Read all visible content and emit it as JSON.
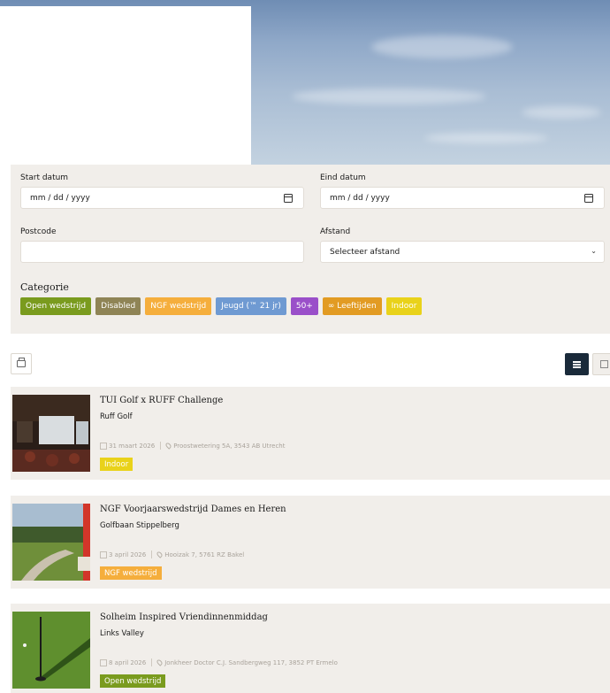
{
  "colors": {
    "panel_bg": "#f1eeea",
    "open": "#7a9b1e",
    "disabled": "#8f8456",
    "ngf": "#f5ae3c",
    "jeugd": "#6f9ad2",
    "plus50": "#9a4fc9",
    "leeftijden": "#e29b23",
    "indoor": "#e9d21a",
    "view_active": "#1a2a3a"
  },
  "filters": {
    "start_label": "Start datum",
    "start_placeholder": "mm / dd / yyyy",
    "end_label": "Eind datum",
    "end_placeholder": "mm / dd / yyyy",
    "postcode_label": "Postcode",
    "postcode_value": "",
    "distance_label": "Afstand",
    "distance_selected": "Selecteer afstand",
    "category_title": "Categorie",
    "categories": [
      {
        "label": "Open wedstrijd",
        "color": "#7a9b1e"
      },
      {
        "label": "Disabled",
        "color": "#8f8456"
      },
      {
        "label": "NGF wedstrijd",
        "color": "#f5ae3c"
      },
      {
        "label": "Jeugd (™ 21 jr)",
        "color": "#6f9ad2"
      },
      {
        "label": "50+",
        "color": "#9a4fc9"
      },
      {
        "label": "∞ Leeftijden",
        "color": "#e29b23"
      },
      {
        "label": "Indoor",
        "color": "#e9d21a"
      }
    ]
  },
  "toolbar": {
    "print_icon": "print-icon",
    "list_view_icon": "list-view-icon",
    "calendar_view_icon": "calendar-view-icon"
  },
  "events": [
    {
      "title": "TUI Golf x RUFF Challenge",
      "venue": "Ruff Golf",
      "date": "31 maart 2026",
      "address": "Proostwetering 5A, 3543 AB Utrecht",
      "tag": "Indoor",
      "tag_color": "#e9d21a"
    },
    {
      "title": "NGF Voorjaarswedstrijd Dames en Heren",
      "venue": "Golfbaan Stippelberg",
      "date": "3 april 2026",
      "address": "Hooizak 7, 5761 RZ Bakel",
      "tag": "NGF wedstrijd",
      "tag_color": "#f5ae3c"
    },
    {
      "title": "Solheim Inspired Vriendinnenmiddag",
      "venue": "Links Valley",
      "date": "8 april 2026",
      "address": "Jonkheer Doctor C.J. Sandbergweg 117, 3852 PT Ermelo",
      "tag": "Open wedstrijd",
      "tag_color": "#7a9b1e"
    }
  ]
}
